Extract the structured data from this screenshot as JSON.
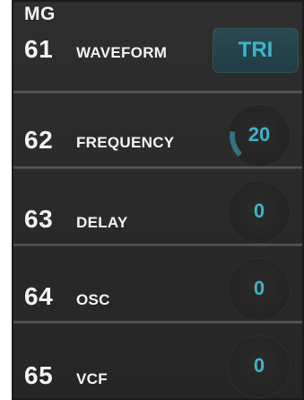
{
  "section": {
    "title": "MG"
  },
  "params": [
    {
      "number": "61",
      "label": "WAVEFORM",
      "value": "TRI"
    },
    {
      "number": "62",
      "label": "FREQUENCY",
      "value": "20",
      "level": 0.2
    },
    {
      "number": "63",
      "label": "DELAY",
      "value": "0",
      "level": 0
    },
    {
      "number": "64",
      "label": "OSC",
      "value": "0",
      "level": 0
    },
    {
      "number": "65",
      "label": "VCF",
      "value": "0",
      "level": 0
    }
  ],
  "colors": {
    "accent": "#3fb3c9",
    "panel": "#2a2a2a",
    "text": "#f2f2f2"
  }
}
